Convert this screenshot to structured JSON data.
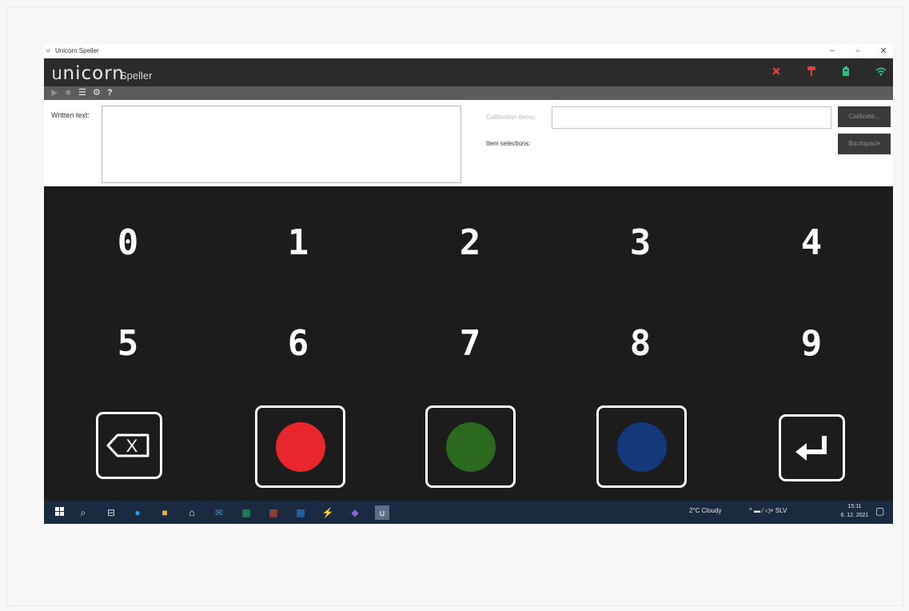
{
  "window": {
    "title": "Unicorn Speller",
    "app_icon": "unicorn-icon",
    "controls": {
      "minimize": "−",
      "maximize": "▫",
      "close": "✕"
    }
  },
  "brand": {
    "logo": "ᥙnicorn",
    "subtitle": "Speller",
    "status_icons": [
      {
        "icon": "amplifier-disconnected-icon",
        "color": "#e0403a"
      },
      {
        "icon": "headset-icon",
        "color": "#e0403a"
      },
      {
        "icon": "battery-icon",
        "color": "#2ec27e"
      },
      {
        "icon": "wifi-icon",
        "color": "#2ec27e"
      }
    ]
  },
  "toolbar": {
    "play": "▶",
    "stop": "■",
    "list": "☰",
    "settings": "⚙",
    "help": "?"
  },
  "form": {
    "written_text_label": "Written text:",
    "written_text_value": "",
    "calibration_items_label": "Calibration items:",
    "calibration_items_value": "",
    "calibrate_button": "Calibrate...",
    "item_selections_label": "Item selections:",
    "backspace_button": "Backspace"
  },
  "speller": {
    "row1": [
      "0",
      "1",
      "2",
      "3",
      "4"
    ],
    "row2": [
      "5",
      "6",
      "7",
      "8",
      "9"
    ],
    "row3": [
      {
        "name": "backspace-icon",
        "glyph": "X"
      },
      {
        "name": "red-circle",
        "color": "#e8262b"
      },
      {
        "name": "green-circle",
        "color": "#2b6a1e"
      },
      {
        "name": "blue-circle",
        "color": "#14387a"
      },
      {
        "name": "enter-icon"
      }
    ]
  },
  "taskbar": {
    "items": [
      "start-icon",
      "search-icon",
      "task-view-icon",
      "edge-icon",
      "file-explorer-icon",
      "store-icon",
      "mail-icon",
      "excel-icon",
      "powerpoint-icon",
      "word-icon",
      "sublime-icon",
      "visual-studio-icon",
      "unicorn-icon"
    ],
    "weather": "2°C Cloudy",
    "tray": "^ ▬ ⁄ ◁× SLV",
    "time": "15:11",
    "date": "6. 12. 2021"
  }
}
